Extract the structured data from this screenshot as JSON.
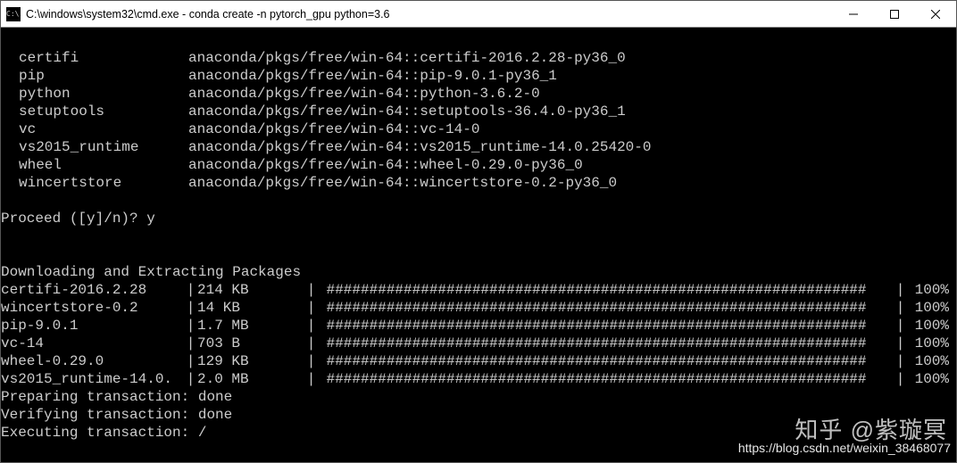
{
  "titlebar": {
    "icon_label": "C:\\.",
    "title": "C:\\windows\\system32\\cmd.exe - conda  create -n pytorch_gpu python=3.6"
  },
  "packages": [
    {
      "name": "certifi",
      "spec": "anaconda/pkgs/free/win-64::certifi-2016.2.28-py36_0"
    },
    {
      "name": "pip",
      "spec": "anaconda/pkgs/free/win-64::pip-9.0.1-py36_1"
    },
    {
      "name": "python",
      "spec": "anaconda/pkgs/free/win-64::python-3.6.2-0"
    },
    {
      "name": "setuptools",
      "spec": "anaconda/pkgs/free/win-64::setuptools-36.4.0-py36_1"
    },
    {
      "name": "vc",
      "spec": "anaconda/pkgs/free/win-64::vc-14-0"
    },
    {
      "name": "vs2015_runtime",
      "spec": "anaconda/pkgs/free/win-64::vs2015_runtime-14.0.25420-0"
    },
    {
      "name": "wheel",
      "spec": "anaconda/pkgs/free/win-64::wheel-0.29.0-py36_0"
    },
    {
      "name": "wincertstore",
      "spec": "anaconda/pkgs/free/win-64::wincertstore-0.2-py36_0"
    }
  ],
  "prompt": {
    "question": "Proceed ([y]/n)? ",
    "answer": "y"
  },
  "download_header": "Downloading and Extracting Packages",
  "downloads": [
    {
      "name": "certifi-2016.2.28",
      "size": "214 KB",
      "pct": "100%"
    },
    {
      "name": "wincertstore-0.2",
      "size": "14 KB",
      "pct": "100%"
    },
    {
      "name": "pip-9.0.1",
      "size": "1.7 MB",
      "pct": "100%"
    },
    {
      "name": "vc-14",
      "size": "703 B",
      "pct": "100%"
    },
    {
      "name": "wheel-0.29.0",
      "size": "129 KB",
      "pct": "100%"
    },
    {
      "name": "vs2015_runtime-14.0.",
      "size": "2.0 MB",
      "pct": "100%"
    }
  ],
  "progress_bar": "###############################################################",
  "transactions": {
    "preparing": {
      "label": "Preparing transaction: ",
      "status": "done"
    },
    "verifying": {
      "label": "Verifying transaction: ",
      "status": "done"
    },
    "executing": {
      "label": "Executing transaction: ",
      "status": "/"
    }
  },
  "watermark": {
    "text": "知乎 @紫璇冥",
    "url": "https://blog.csdn.net/weixin_38468077"
  }
}
